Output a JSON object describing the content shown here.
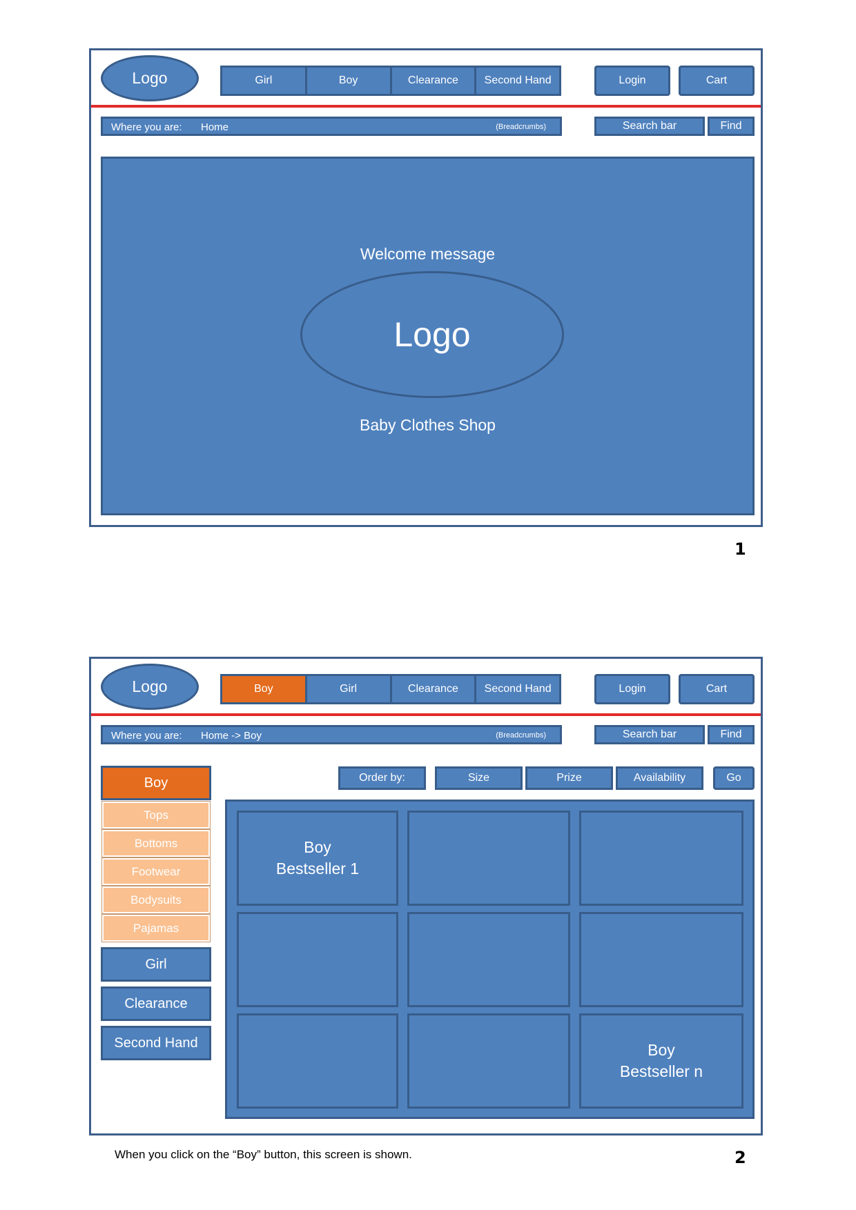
{
  "screen1": {
    "logo": "Logo",
    "nav": [
      "Girl",
      "Boy",
      "Clearance",
      "Second Hand"
    ],
    "login": "Login",
    "cart": "Cart",
    "breadcrumb": {
      "where": "Where you are:",
      "path": "Home",
      "note": "(Breadcrumbs)"
    },
    "search": "Search bar",
    "find": "Find",
    "welcome": "Welcome message",
    "big_logo": "Logo",
    "shop_name": "Baby Clothes Shop",
    "page_number": "1"
  },
  "screen2": {
    "logo": "Logo",
    "nav": [
      "Boy",
      "Girl",
      "Clearance",
      "Second Hand"
    ],
    "nav_active": "Boy",
    "login": "Login",
    "cart": "Cart",
    "breadcrumb": {
      "where": "Where you are:",
      "path": "Home -> Boy",
      "note": "(Breadcrumbs)"
    },
    "search": "Search bar",
    "find": "Find",
    "sidebar": {
      "active": "Boy",
      "sub": [
        "Tops",
        "Bottoms",
        "Footwear",
        "Bodysuits",
        "Pajamas"
      ],
      "others": [
        "Girl",
        "Clearance",
        "Second Hand"
      ]
    },
    "order": {
      "label": "Order by:",
      "options": [
        "Size",
        "Prize",
        "Availability"
      ],
      "go": "Go"
    },
    "tiles": [
      "Boy\nBestseller 1",
      "",
      "",
      "",
      "",
      "",
      "",
      "",
      "Boy\nBestseller n"
    ],
    "caption": "When you click on the “Boy” button, this screen is shown.",
    "page_number": "2"
  },
  "colors": {
    "box_fill": "#4f81bd",
    "box_border": "#385d8a",
    "active": "#e46c1e",
    "submenu": "#fac090",
    "divider": "#e32b2b"
  }
}
